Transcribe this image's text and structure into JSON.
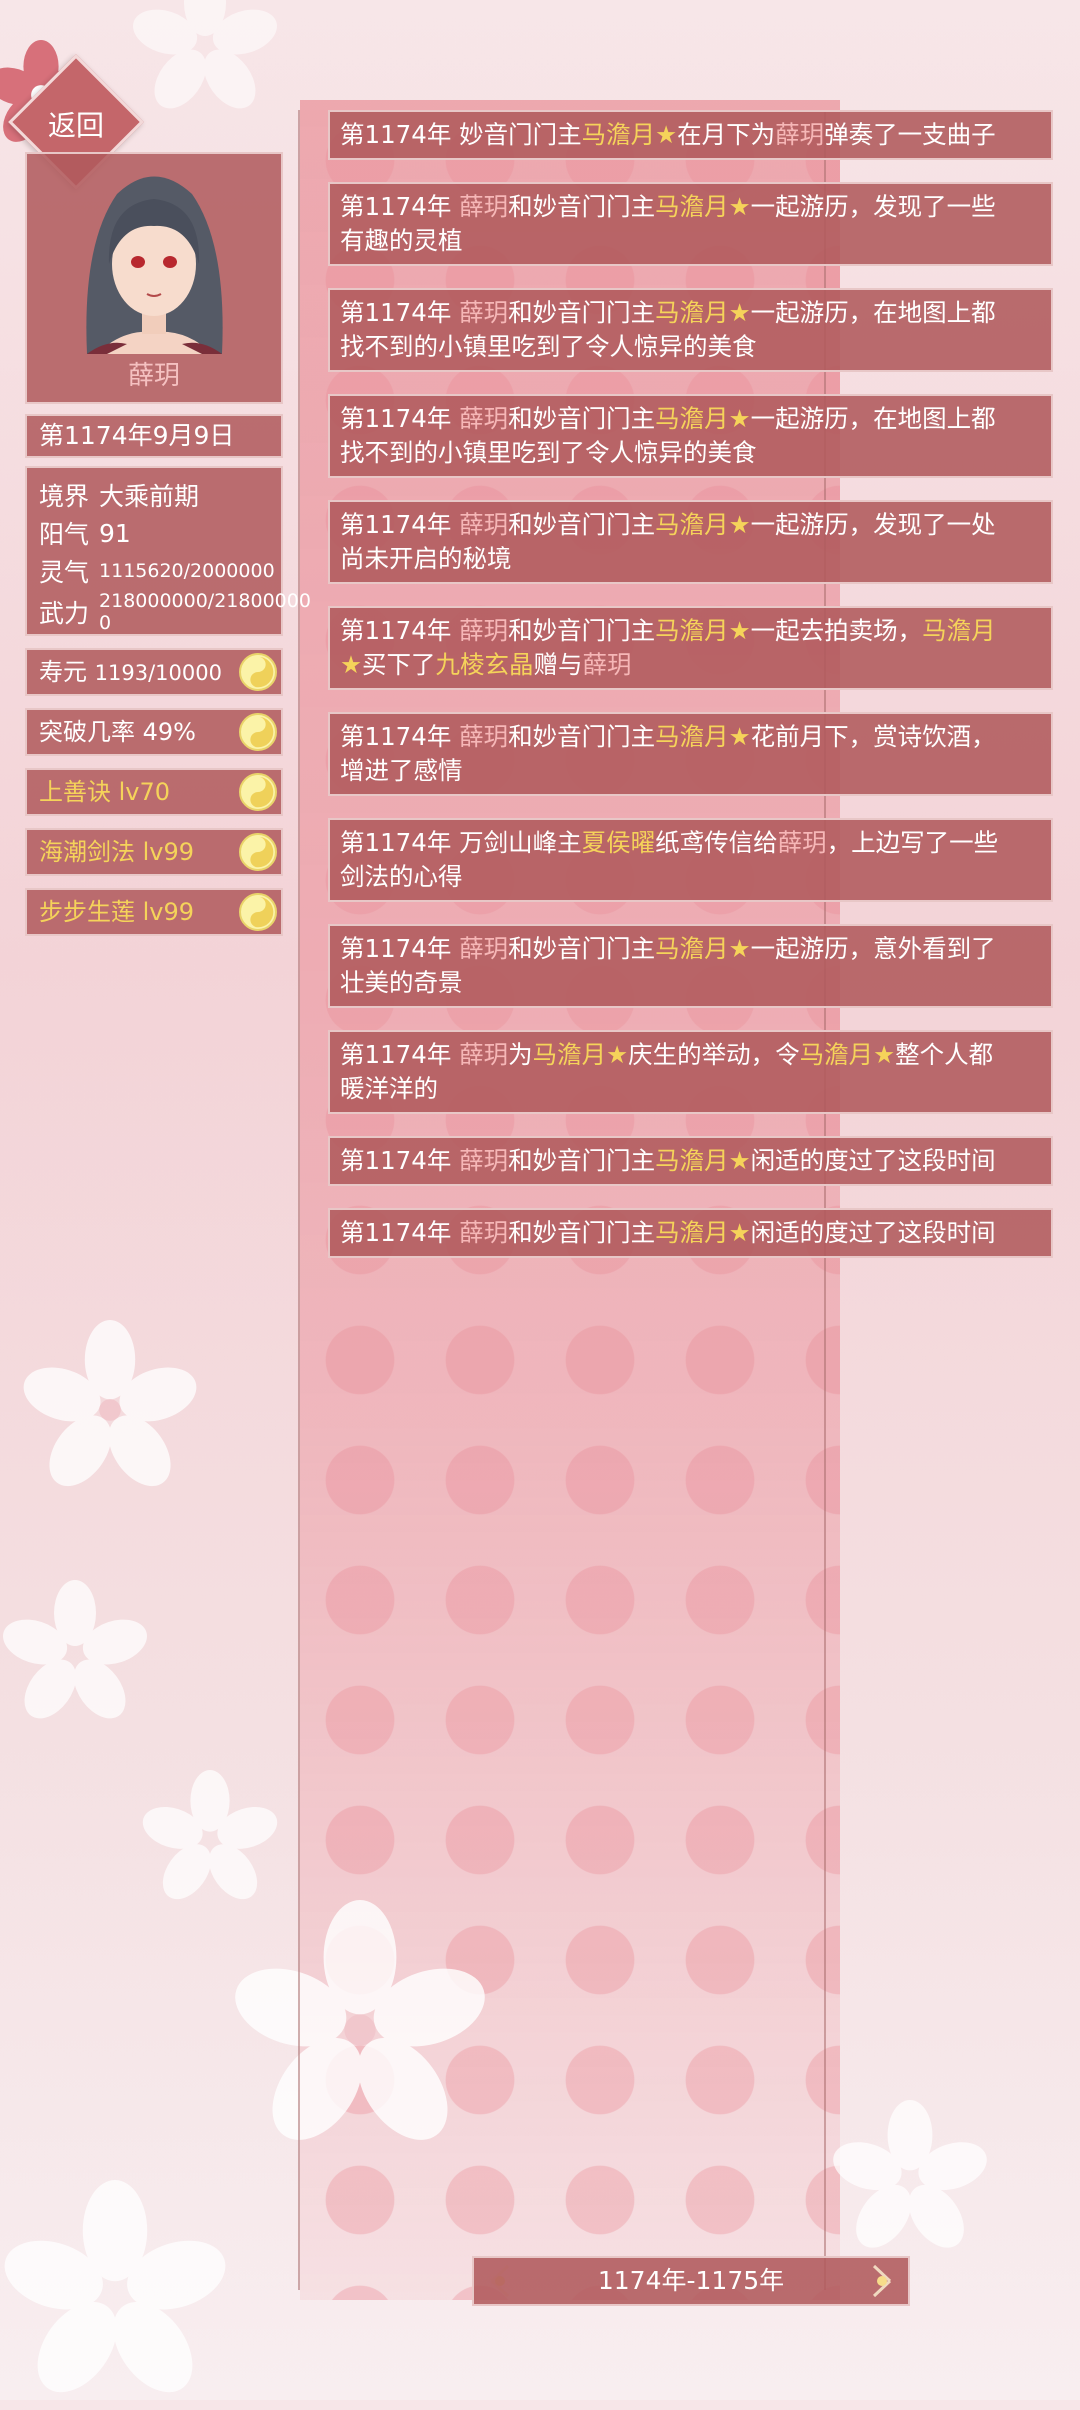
{
  "back_label": "返回",
  "character": {
    "name": "薛玥"
  },
  "date": "第1174年9月9日",
  "attributes": {
    "realm_label": "境界",
    "realm_value": "大乘前期",
    "yang_label": "阳气",
    "yang_value": "91",
    "ling_label": "灵气",
    "ling_value": "1115620/2000000",
    "wu_label": "武力",
    "wu_value_line1": "218000000/21800000",
    "wu_value_line2": "0"
  },
  "stats": {
    "lifespan_label": "寿元",
    "lifespan_value": "1193/10000",
    "breakthrough_label": "突破几率",
    "breakthrough_value": "49%"
  },
  "skills": [
    "上善诀 lv70",
    "海潮剑法 lv99",
    "步步生莲 lv99"
  ],
  "events": [
    {
      "lines": [
        [
          [
            "n",
            "第1174年 妙音门门主"
          ],
          [
            "y",
            "马澹月"
          ],
          [
            "y",
            "★"
          ],
          [
            "n",
            "在月下为"
          ],
          [
            "p",
            "薛玥"
          ],
          [
            "n",
            "弹奏了一支曲子"
          ]
        ]
      ]
    },
    {
      "lines": [
        [
          [
            "n",
            "第1174年 "
          ],
          [
            "p",
            "薛玥"
          ],
          [
            "n",
            "和妙音门门主"
          ],
          [
            "y",
            "马澹月"
          ],
          [
            "y",
            "★"
          ],
          [
            "n",
            "一起游历，发现了一些"
          ]
        ],
        [
          [
            "n",
            "有趣的灵植"
          ]
        ]
      ]
    },
    {
      "lines": [
        [
          [
            "n",
            "第1174年 "
          ],
          [
            "p",
            "薛玥"
          ],
          [
            "n",
            "和妙音门门主"
          ],
          [
            "y",
            "马澹月"
          ],
          [
            "y",
            "★"
          ],
          [
            "n",
            "一起游历，在地图上都"
          ]
        ],
        [
          [
            "n",
            "找不到的小镇里吃到了令人惊异的美食"
          ]
        ]
      ]
    },
    {
      "lines": [
        [
          [
            "n",
            "第1174年 "
          ],
          [
            "p",
            "薛玥"
          ],
          [
            "n",
            "和妙音门门主"
          ],
          [
            "y",
            "马澹月"
          ],
          [
            "y",
            "★"
          ],
          [
            "n",
            "一起游历，在地图上都"
          ]
        ],
        [
          [
            "n",
            "找不到的小镇里吃到了令人惊异的美食"
          ]
        ]
      ]
    },
    {
      "lines": [
        [
          [
            "n",
            "第1174年 "
          ],
          [
            "p",
            "薛玥"
          ],
          [
            "n",
            "和妙音门门主"
          ],
          [
            "y",
            "马澹月"
          ],
          [
            "y",
            "★"
          ],
          [
            "n",
            "一起游历，发现了一处"
          ]
        ],
        [
          [
            "n",
            "尚未开启的秘境"
          ]
        ]
      ]
    },
    {
      "lines": [
        [
          [
            "n",
            "第1174年 "
          ],
          [
            "p",
            "薛玥"
          ],
          [
            "n",
            "和妙音门门主"
          ],
          [
            "y",
            "马澹月"
          ],
          [
            "y",
            "★"
          ],
          [
            "n",
            "一起去拍卖场，"
          ],
          [
            "y",
            "马澹月"
          ]
        ],
        [
          [
            "y",
            "★"
          ],
          [
            "n",
            "买下了"
          ],
          [
            "y",
            "九棱玄晶"
          ],
          [
            "n",
            "赠与"
          ],
          [
            "p",
            "薛玥"
          ]
        ]
      ]
    },
    {
      "lines": [
        [
          [
            "n",
            "第1174年 "
          ],
          [
            "p",
            "薛玥"
          ],
          [
            "n",
            "和妙音门门主"
          ],
          [
            "y",
            "马澹月"
          ],
          [
            "y",
            "★"
          ],
          [
            "n",
            "花前月下，赏诗饮酒，"
          ]
        ],
        [
          [
            "n",
            "增进了感情"
          ]
        ]
      ]
    },
    {
      "lines": [
        [
          [
            "n",
            "第1174年 万剑山峰主"
          ],
          [
            "y",
            "夏侯曜"
          ],
          [
            "n",
            "纸鸢传信给"
          ],
          [
            "p",
            "薛玥"
          ],
          [
            "n",
            "，上边写了一些"
          ]
        ],
        [
          [
            "n",
            "剑法的心得"
          ]
        ]
      ]
    },
    {
      "lines": [
        [
          [
            "n",
            "第1174年 "
          ],
          [
            "p",
            "薛玥"
          ],
          [
            "n",
            "和妙音门门主"
          ],
          [
            "y",
            "马澹月"
          ],
          [
            "y",
            "★"
          ],
          [
            "n",
            "一起游历，意外看到了"
          ]
        ],
        [
          [
            "n",
            "壮美的奇景"
          ]
        ]
      ]
    },
    {
      "lines": [
        [
          [
            "n",
            "第1174年 "
          ],
          [
            "p",
            "薛玥"
          ],
          [
            "n",
            "为"
          ],
          [
            "y",
            "马澹月"
          ],
          [
            "y",
            "★"
          ],
          [
            "n",
            "庆生的举动，令"
          ],
          [
            "y",
            "马澹月"
          ],
          [
            "y",
            "★"
          ],
          [
            "n",
            "整个人都"
          ]
        ],
        [
          [
            "n",
            "暖洋洋的"
          ]
        ]
      ]
    },
    {
      "lines": [
        [
          [
            "n",
            "第1174年 "
          ],
          [
            "p",
            "薛玥"
          ],
          [
            "n",
            "和妙音门门主"
          ],
          [
            "y",
            "马澹月"
          ],
          [
            "y",
            "★"
          ],
          [
            "n",
            "闲适的度过了这段时间"
          ]
        ]
      ]
    },
    {
      "lines": [
        [
          [
            "n",
            "第1174年 "
          ],
          [
            "p",
            "薛玥"
          ],
          [
            "n",
            "和妙音门门主"
          ],
          [
            "y",
            "马澹月"
          ],
          [
            "y",
            "★"
          ],
          [
            "n",
            "闲适的度过了这段时间"
          ]
        ]
      ]
    }
  ],
  "year_range": "1174年-1175年",
  "colors": {
    "panel": "#b05a5c",
    "highlight_yellow": "#f5d35a",
    "highlight_pink": "#f6b7b7"
  }
}
